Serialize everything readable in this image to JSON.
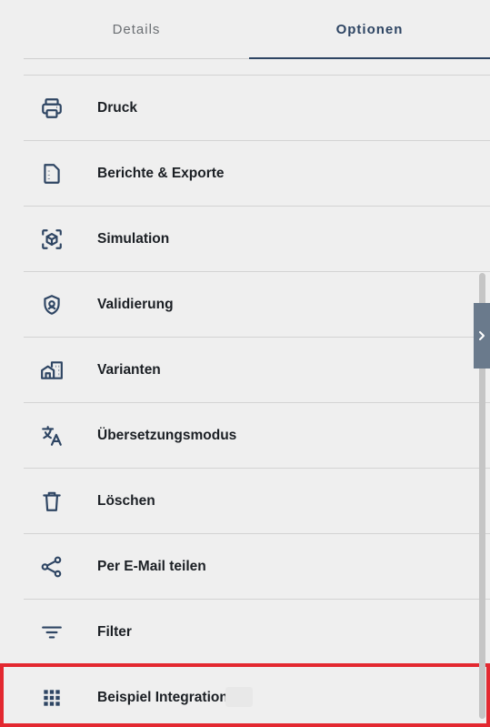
{
  "tabs": [
    {
      "label": "Details"
    },
    {
      "label": "Optionen"
    }
  ],
  "menu": {
    "items": [
      {
        "label": "Druck",
        "icon": "printer-icon"
      },
      {
        "label": "Berichte & Exporte",
        "icon": "document-report-icon"
      },
      {
        "label": "Simulation",
        "icon": "cube-scan-icon"
      },
      {
        "label": "Validierung",
        "icon": "shield-check-icon"
      },
      {
        "label": "Varianten",
        "icon": "buildings-icon"
      },
      {
        "label": "Übersetzungsmodus",
        "icon": "translate-icon"
      },
      {
        "label": "Löschen",
        "icon": "trash-icon"
      },
      {
        "label": "Per E-Mail teilen",
        "icon": "share-icon"
      },
      {
        "label": "Filter",
        "icon": "filter-icon"
      },
      {
        "label": "Beispiel Integration",
        "icon": "grid-apps-icon"
      }
    ]
  },
  "colors": {
    "accent": "#2e4563",
    "icon": "#2e4563",
    "highlight": "#e32830",
    "background": "#efefef"
  }
}
